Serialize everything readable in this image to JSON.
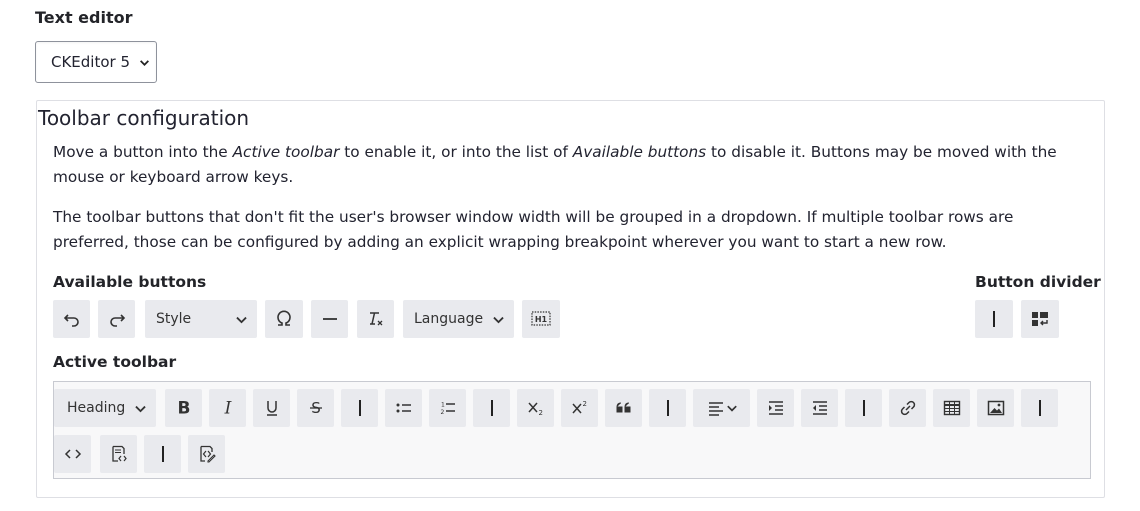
{
  "field": {
    "label": "Text editor"
  },
  "editor_select": {
    "value": "CKEditor 5"
  },
  "toolbar_config": {
    "legend": "Toolbar configuration",
    "para1": {
      "p1": "Move a button into the ",
      "em1": "Active toolbar",
      "p2": " to enable it, or into the list of ",
      "em2": "Available buttons",
      "p3": " to disable it. Buttons may be moved with the mouse or keyboard arrow keys."
    },
    "para2": "The toolbar buttons that don't fit the user's browser window width will be grouped in a dropdown. If multiple toolbar rows are preferred, those can be configured by adding an explicit wrapping breakpoint wherever you want to start a new row.",
    "available": {
      "title": "Available buttons",
      "style_label": "Style",
      "language_label": "Language",
      "buttons": [
        "undo-icon",
        "redo-icon",
        "style-dropdown",
        "special-characters-icon",
        "horizontal-line-icon",
        "remove-format-icon",
        "language-dropdown",
        "source-editing-h1-icon"
      ]
    },
    "divider": {
      "title": "Button divider",
      "buttons": [
        "divider-icon",
        "wrapping-breakpoint-icon"
      ]
    },
    "active": {
      "title": "Active toolbar",
      "heading_label": "Heading",
      "buttons": [
        "heading-dropdown",
        "bold-icon",
        "italic-icon",
        "underline-icon",
        "strikethrough-icon",
        "divider-icon",
        "bulleted-list-icon",
        "numbered-list-icon",
        "divider-icon",
        "subscript-icon",
        "superscript-icon",
        "blockquote-icon",
        "divider-icon",
        "alignment-dropdown",
        "indent-icon",
        "outdent-icon",
        "divider-icon",
        "link-icon",
        "table-icon",
        "image-icon",
        "divider-icon",
        "code-icon",
        "source-editing-icon",
        "divider-icon",
        "source-icon"
      ]
    }
  },
  "colors": {
    "button_bg": "#e9eaee",
    "border": "#c8cad1",
    "text": "#222330"
  }
}
